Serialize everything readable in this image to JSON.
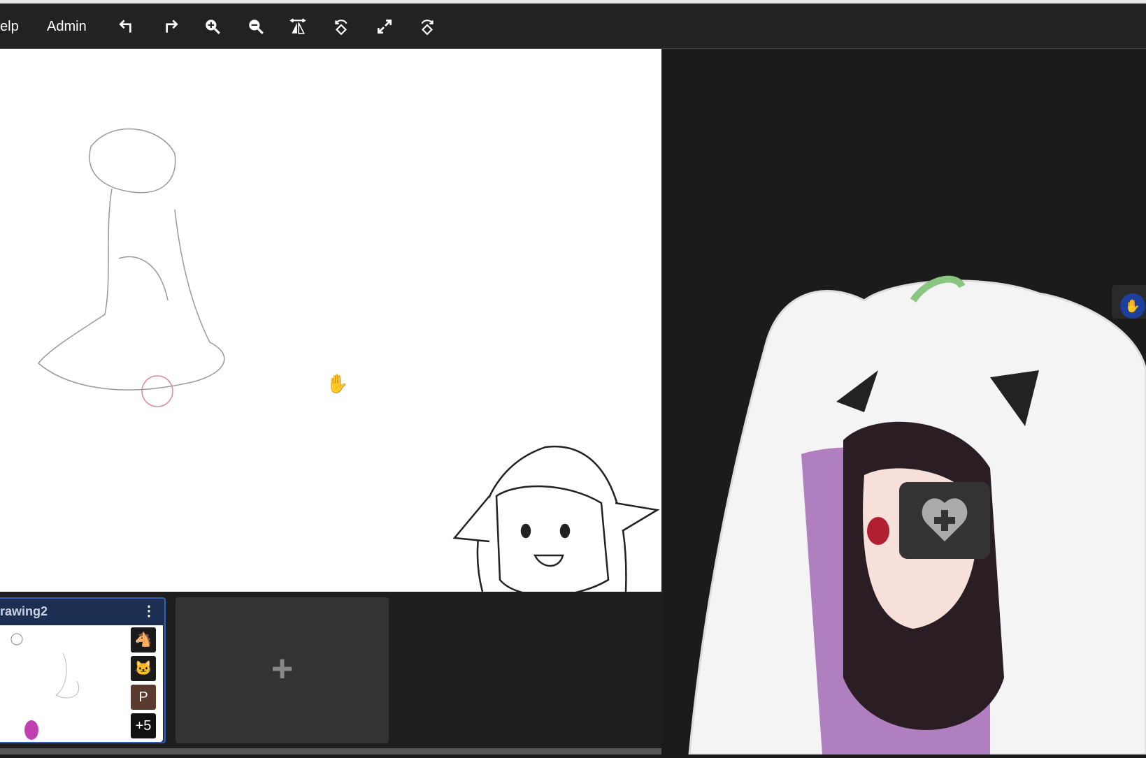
{
  "toolbar": {
    "menu_items": [
      "elp",
      "Admin"
    ],
    "icons": [
      "undo-icon",
      "redo-icon",
      "zoom-in-icon",
      "zoom-out-icon",
      "flip-horizontal-icon",
      "rotate-left-icon",
      "fullscreen-icon",
      "rotate-right-icon"
    ]
  },
  "pages": {
    "current": {
      "title": "rawing2",
      "menu_icon": "more-vertical-icon",
      "participants": [
        {
          "type": "avatar",
          "icon": "horse-icon",
          "color": "#1a1a1a"
        },
        {
          "type": "avatar",
          "icon": "cat-icon",
          "color": "#1a1a1a"
        },
        {
          "type": "initial",
          "label": "P",
          "color": "#5a3b2e"
        },
        {
          "type": "overflow",
          "label": "+5",
          "color": "#111111"
        }
      ]
    },
    "add_label": "+"
  },
  "colors": {
    "toolbar": "#222222",
    "card_accent": "#2f5fb8",
    "card_bg": "#1c2e52"
  }
}
